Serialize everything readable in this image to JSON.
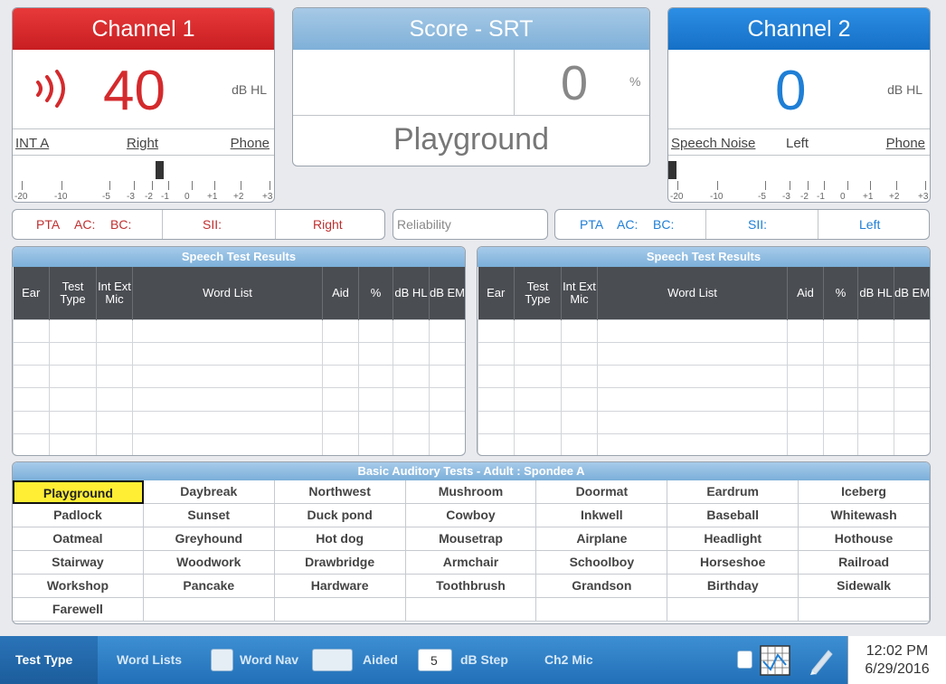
{
  "channel1": {
    "title": "Channel 1",
    "level": "40",
    "unit": "dB HL",
    "signal": "INT A",
    "ear": "Right",
    "transducer": "Phone",
    "ticks": [
      "-20",
      "-10",
      "-5",
      "-3",
      "-2",
      "-1",
      "0",
      "+1",
      "+2",
      "+3"
    ]
  },
  "score": {
    "title": "Score - SRT",
    "value": "0",
    "unit": "%",
    "word": "Playground"
  },
  "channel2": {
    "title": "Channel 2",
    "level": "0",
    "unit": "dB HL",
    "signal": "Speech Noise",
    "ear": "Left",
    "transducer": "Phone",
    "ticks": [
      "-20",
      "-10",
      "-5",
      "-3",
      "-2",
      "-1",
      "0",
      "+1",
      "+2",
      "+3"
    ]
  },
  "info_left": {
    "pta": "PTA",
    "ac": "AC:",
    "bc": "BC:",
    "sii": "SII:",
    "ear": "Right"
  },
  "reliability": "Reliability",
  "info_right": {
    "pta": "PTA",
    "ac": "AC:",
    "bc": "BC:",
    "sii": "SII:",
    "ear": "Left"
  },
  "results": {
    "title": "Speech Test Results",
    "columns": [
      "Ear",
      "Test Type",
      "Int Ext Mic",
      "Word List",
      "Aid",
      "%",
      "dB HL",
      "dB EM"
    ]
  },
  "words": {
    "title": "Basic Auditory Tests - Adult : Spondee A",
    "selected": "Playground",
    "items": [
      "Playground",
      "Daybreak",
      "Northwest",
      "Mushroom",
      "Doormat",
      "Eardrum",
      "Iceberg",
      "Padlock",
      "Sunset",
      "Duck pond",
      "Cowboy",
      "Inkwell",
      "Baseball",
      "Whitewash",
      "Oatmeal",
      "Greyhound",
      "Hot dog",
      "Mousetrap",
      "Airplane",
      "Headlight",
      "Hothouse",
      "Stairway",
      "Woodwork",
      "Drawbridge",
      "Armchair",
      "Schoolboy",
      "Horseshoe",
      "Railroad",
      "Workshop",
      "Pancake",
      "Hardware",
      "Toothbrush",
      "Grandson",
      "Birthday",
      "Sidewalk",
      "Farewell",
      "",
      "",
      "",
      "",
      "",
      ""
    ]
  },
  "toolbar": {
    "test_type": "Test Type",
    "word_lists": "Word Lists",
    "word_nav": "Word Nav",
    "aided": "Aided",
    "db_step_value": "5",
    "db_step": "dB Step",
    "ch2_mic": "Ch2 Mic",
    "time": "12:02 PM",
    "date": "6/29/2016"
  },
  "colors": {
    "channel1": "#d42a2d",
    "channel2": "#1f7fd6",
    "accent": "#7fb0d8",
    "selected_word": "#ffee33"
  },
  "icons": [
    "sound-wave-icon",
    "chart-icon",
    "pencil-icon"
  ]
}
